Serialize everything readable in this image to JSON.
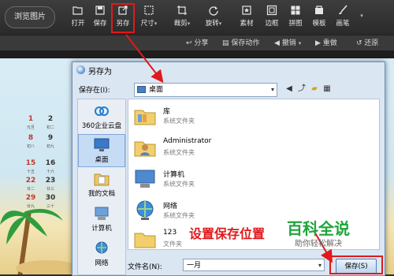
{
  "toolbar": {
    "browse_label": "浏览图片",
    "tools": [
      {
        "label": "打开",
        "icon": "folder-open-icon"
      },
      {
        "label": "保存",
        "icon": "save-icon"
      },
      {
        "label": "另存",
        "icon": "save-as-icon"
      },
      {
        "label": "尺寸",
        "icon": "resize-icon"
      },
      {
        "label": "裁剪",
        "icon": "crop-icon"
      },
      {
        "label": "旋转",
        "icon": "rotate-icon"
      },
      {
        "label": "素材",
        "icon": "sticker-icon"
      },
      {
        "label": "边框",
        "icon": "border-icon"
      },
      {
        "label": "拼图",
        "icon": "collage-icon"
      },
      {
        "label": "模板",
        "icon": "template-icon"
      },
      {
        "label": "画笔",
        "icon": "brush-icon"
      }
    ],
    "dropdown_glyph": "▾"
  },
  "toolbar2": {
    "share": "分享",
    "save_action": "保存动作",
    "undo": "撤销",
    "redo": "重做",
    "restore": "还原"
  },
  "calendar": {
    "days": [
      "1",
      "2",
      "8",
      "9",
      "15",
      "16",
      "22",
      "23",
      "29",
      "30"
    ],
    "lunar": [
      "元旦",
      "初二",
      "初八",
      "初九",
      "十五",
      "十六",
      "廿二",
      "廿三",
      "廿九",
      "三十"
    ]
  },
  "dialog": {
    "title": "另存为",
    "save_in_label": "保存在(I):",
    "save_in_value": "桌面",
    "places": [
      {
        "label": "360企业云盘",
        "icon": "cloud-icon"
      },
      {
        "label": "桌面",
        "icon": "desktop-icon"
      },
      {
        "label": "我的文档",
        "icon": "documents-icon"
      },
      {
        "label": "计算机",
        "icon": "computer-icon"
      },
      {
        "label": "网络",
        "icon": "network-icon"
      }
    ],
    "files": [
      {
        "name": "库",
        "sub": "系统文件夹",
        "icon": "library-icon"
      },
      {
        "name": "Administrator",
        "sub": "系统文件夹",
        "icon": "user-folder-icon"
      },
      {
        "name": "计算机",
        "sub": "系统文件夹",
        "icon": "computer-icon"
      },
      {
        "name": "网络",
        "sub": "系统文件夹",
        "icon": "network-icon"
      },
      {
        "name": "123",
        "sub": "文件夹",
        "icon": "folder-icon"
      }
    ],
    "filename_label": "文件名(N):",
    "filename_value": "一月",
    "save_button": "保存(S)"
  },
  "annotation": {
    "instruction": "设置保存位置",
    "brand_title": "百科全说",
    "brand_subtitle": "助你轻松解决"
  },
  "colors": {
    "highlight_red": "#e0191b",
    "brand_green": "#1fa53a"
  }
}
